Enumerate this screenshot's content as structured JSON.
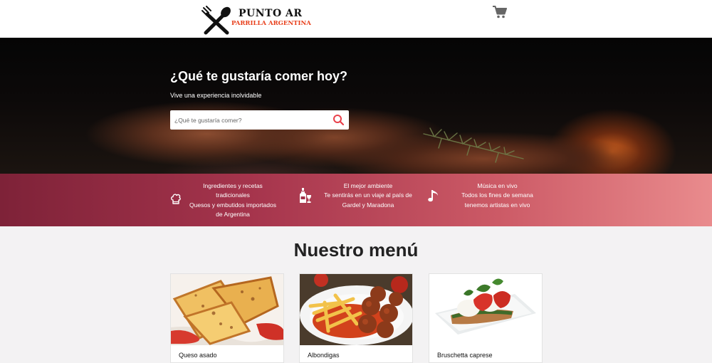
{
  "brand": {
    "title": "PUNTO AR",
    "subtitle": "PARRILLA ARGENTINA",
    "accent": "#e8401c"
  },
  "header": {
    "cart_icon": "cart-icon"
  },
  "hero": {
    "title": "¿Qué te gustaría comer hoy?",
    "subtitle": "Vive una experiencia inolvidable",
    "search": {
      "placeholder": "¿Qué te gustaría comer?",
      "value": ""
    },
    "search_icon": "search-icon",
    "search_color": "#e8404a"
  },
  "features": [
    {
      "icon": "chef-hat-icon",
      "lines": [
        "Ingredientes y recetas",
        "tradicionales",
        "Quesos y embutidos importados",
        "de Argentina"
      ]
    },
    {
      "icon": "wine-icon",
      "lines": [
        "El mejor ambiente",
        "Te sentirás en un viaje al país de",
        "Gardel y Maradona"
      ]
    },
    {
      "icon": "music-note-icon",
      "lines": [
        "Música en vivo",
        "Todos los fines de semana",
        "tenemos artistas en vivo"
      ]
    }
  ],
  "menu": {
    "title": "Nuestro menú",
    "items": [
      {
        "name": "Queso asado",
        "image": "queso-asado-image"
      },
      {
        "name": "Albondigas",
        "image": "albondigas-image"
      },
      {
        "name": "Bruschetta caprese",
        "image": "bruschetta-caprese-image"
      }
    ]
  },
  "colors": {
    "band_start": "#7e2238",
    "band_end": "#e98b8d",
    "page_bg": "#f3f2f3"
  }
}
